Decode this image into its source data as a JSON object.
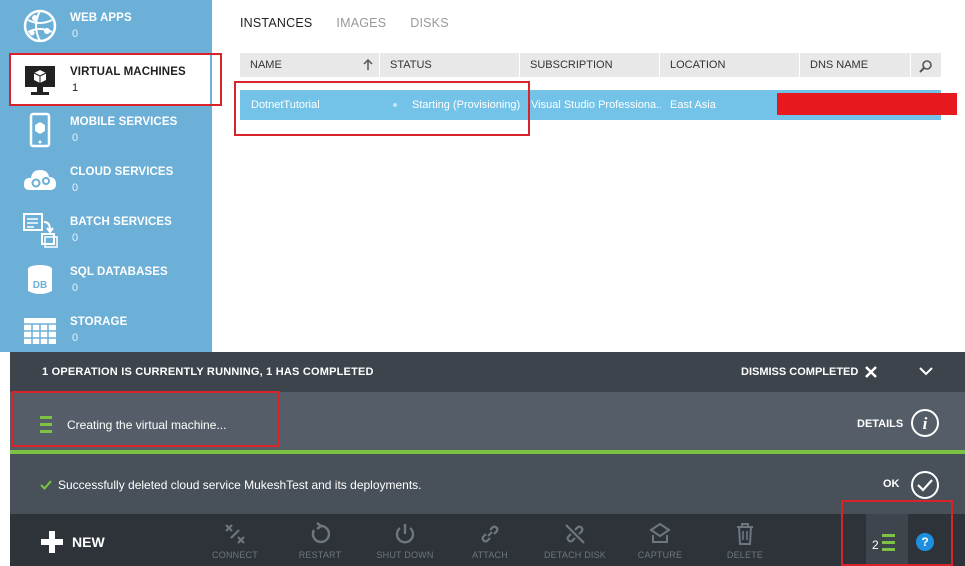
{
  "sidebar": {
    "items": [
      {
        "label": "WEB APPS",
        "count": "0",
        "icon": "globe-icon"
      },
      {
        "label": "VIRTUAL MACHINES",
        "count": "1",
        "icon": "monitor-icon"
      },
      {
        "label": "MOBILE SERVICES",
        "count": "0",
        "icon": "mobile-icon"
      },
      {
        "label": "CLOUD SERVICES",
        "count": "0",
        "icon": "cloud-gear-icon"
      },
      {
        "label": "BATCH SERVICES",
        "count": "0",
        "icon": "batch-icon"
      },
      {
        "label": "SQL DATABASES",
        "count": "0",
        "icon": "database-icon"
      },
      {
        "label": "STORAGE",
        "count": "0",
        "icon": "storage-grid-icon"
      }
    ]
  },
  "tabs": [
    "INSTANCES",
    "IMAGES",
    "DISKS"
  ],
  "table": {
    "columns": [
      "NAME",
      "STATUS",
      "SUBSCRIPTION",
      "LOCATION",
      "DNS NAME"
    ],
    "rows": [
      {
        "name": "DotnetTutorial",
        "status": "Starting (Provisioning)",
        "subscription": "Visual Studio Professiona...",
        "location": "East Asia",
        "dns": ""
      }
    ]
  },
  "notifications": {
    "header": "1 OPERATION IS CURRENTLY RUNNING, 1 HAS COMPLETED",
    "dismiss_label": "DISMISS COMPLETED",
    "running_text": "Creating the virtual machine...",
    "details_label": "DETAILS",
    "completed_text": "Successfully deleted cloud service MukeshTest and its deployments.",
    "ok_label": "OK"
  },
  "commandbar": {
    "new_label": "NEW",
    "commands": [
      "CONNECT",
      "RESTART",
      "SHUT DOWN",
      "ATTACH",
      "DETACH DISK",
      "CAPTURE",
      "DELETE"
    ],
    "ops_count": "2",
    "help_label": "?"
  },
  "colors": {
    "sidebar": "#6cb0d8",
    "row_selected": "#73c2e8",
    "notification": "#485059",
    "commandbar": "#2d3339",
    "progress": "#7dc242",
    "highlight": "#d9232b"
  }
}
